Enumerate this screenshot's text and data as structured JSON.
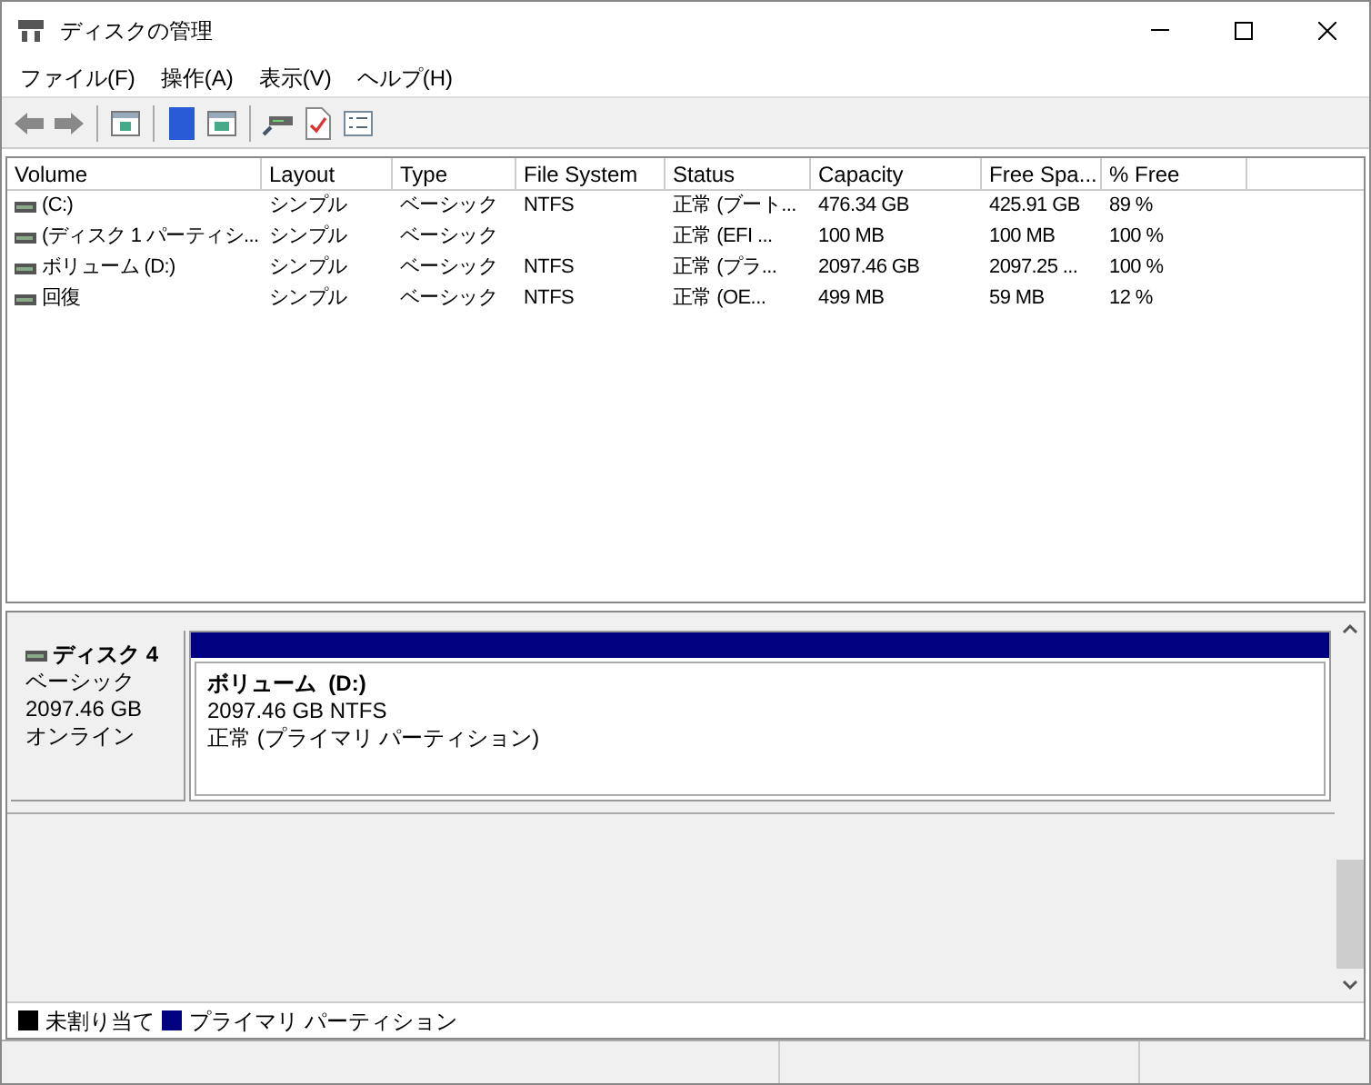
{
  "window": {
    "title": "ディスクの管理"
  },
  "menu": [
    "ファイル(F)",
    "操作(A)",
    "表示(V)",
    "ヘルプ(H)"
  ],
  "table": {
    "columns": [
      "Volume",
      "Layout",
      "Type",
      "File System",
      "Status",
      "Capacity",
      "Free Spa...",
      "% Free"
    ],
    "rows": [
      {
        "cells": [
          "(C:)",
          "シンプル",
          "ベーシック",
          "NTFS",
          "正常 (ブート...",
          "476.34 GB",
          "425.91 GB",
          "89 %"
        ]
      },
      {
        "cells": [
          "(ディスク 1 パーティシ...",
          "シンプル",
          "ベーシック",
          "",
          "正常 (EFI ...",
          "100 MB",
          "100 MB",
          "100 %"
        ]
      },
      {
        "cells": [
          "ボリューム (D:)",
          "シンプル",
          "ベーシック",
          "NTFS",
          "正常 (プラ...",
          "2097.46 GB",
          "2097.25 ...",
          "100 %"
        ]
      },
      {
        "cells": [
          "回復",
          "シンプル",
          "ベーシック",
          "NTFS",
          "正常 (OE...",
          "499 MB",
          "59 MB",
          "12 %"
        ]
      }
    ]
  },
  "disk": {
    "name": "ディスク 4",
    "type": "ベーシック",
    "size": "2097.46 GB",
    "state": "オンライン",
    "partition": {
      "name": "ボリューム  (D:)",
      "size": "2097.46 GB NTFS",
      "status": "正常 (プライマリ パーティション)",
      "color": "#000080"
    }
  },
  "legend": [
    {
      "label": "未割り当て",
      "color": "#000000"
    },
    {
      "label": "プライマリ パーティション",
      "color": "#000080"
    }
  ]
}
